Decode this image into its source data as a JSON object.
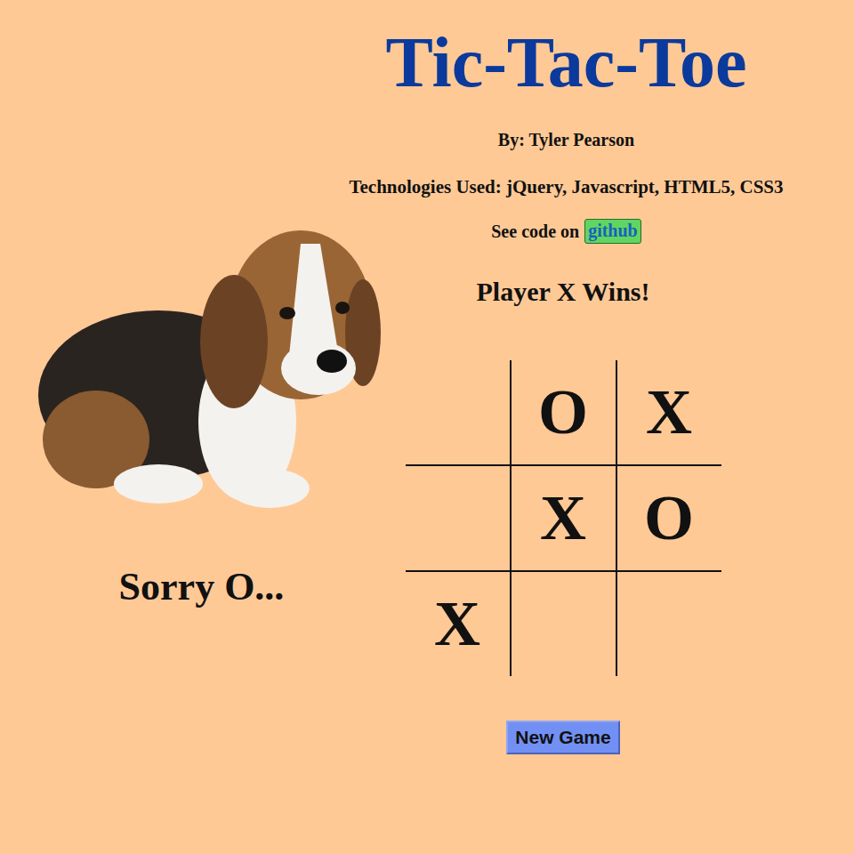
{
  "header": {
    "title": "Tic-Tac-Toe",
    "author": "By: Tyler Pearson",
    "technologies": "Technologies Used: jQuery, Javascript, HTML5, CSS3",
    "code_link": {
      "prefix": "See code on",
      "label": "github"
    }
  },
  "status": "Player X Wins!",
  "loser_message": "Sorry O...",
  "board": {
    "cells": [
      {
        "mark": ""
      },
      {
        "mark": "O"
      },
      {
        "mark": "X"
      },
      {
        "mark": ""
      },
      {
        "mark": "X"
      },
      {
        "mark": "O"
      },
      {
        "mark": "X"
      },
      {
        "mark": ""
      },
      {
        "mark": ""
      }
    ]
  },
  "buttons": [
    "New Game"
  ]
}
